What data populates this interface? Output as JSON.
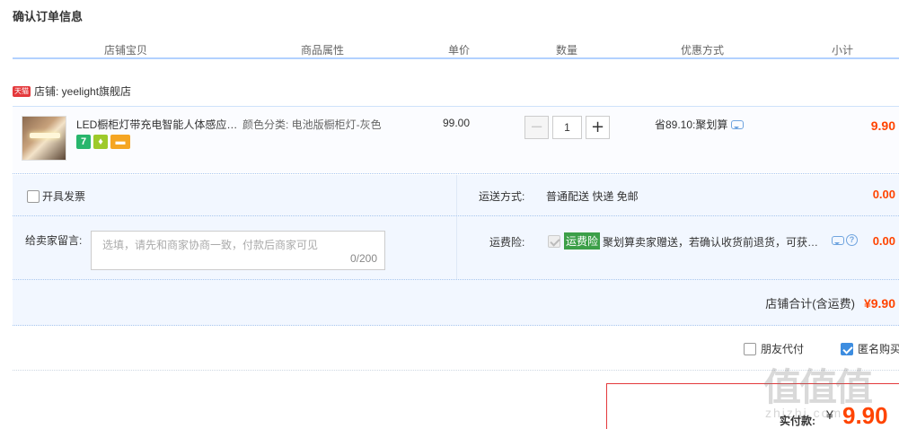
{
  "page": {
    "title": "确认订单信息"
  },
  "columns": [
    "店铺宝贝",
    "商品属性",
    "单价",
    "数量",
    "优惠方式",
    "小计"
  ],
  "shop": {
    "badge": "天猫",
    "label": "店铺: yeelight旗舰店"
  },
  "item": {
    "title": "LED橱柜灯带充电智能人体感应…",
    "icons": [
      "7-day-return-icon",
      "bulb-icon",
      "card-icon"
    ],
    "attr": "颜色分类: 电池版橱柜灯-灰色",
    "price": "99.00",
    "qty_minus": "−",
    "qty": "1",
    "qty_plus": "+",
    "discount": "省89.10:聚划算",
    "subtotal": "9.90"
  },
  "invoice": {
    "label": "开具发票",
    "checked": false
  },
  "shipping": {
    "label": "运送方式:",
    "value": "普通配送 快递 免邮",
    "fee": "0.00"
  },
  "message": {
    "label": "给卖家留言:",
    "placeholder": "选填，请先和商家协商一致，付款后商家可见",
    "count": "0/200"
  },
  "insurance": {
    "label": "运费险:",
    "badge": "运费险",
    "desc": "聚划算卖家赠送，若确认收货前退货，可获…",
    "fee": "0.00",
    "help": "?"
  },
  "shop_total": {
    "label": "店铺合计(含运费)",
    "value": "¥9.90"
  },
  "extras": {
    "friend_pay": "朋友代付",
    "anonymous": "匿名购买"
  },
  "payment": {
    "label": "实付款:",
    "currency": "¥",
    "amount": "9.90"
  },
  "watermark": {
    "main": "值值值",
    "sub": "zhizhi.com"
  },
  "colors": {
    "accent": "#ff4400",
    "header_border": "#b2d1ff",
    "panel_bg": "#f2f7ff",
    "pay_border": "#e4393c"
  }
}
